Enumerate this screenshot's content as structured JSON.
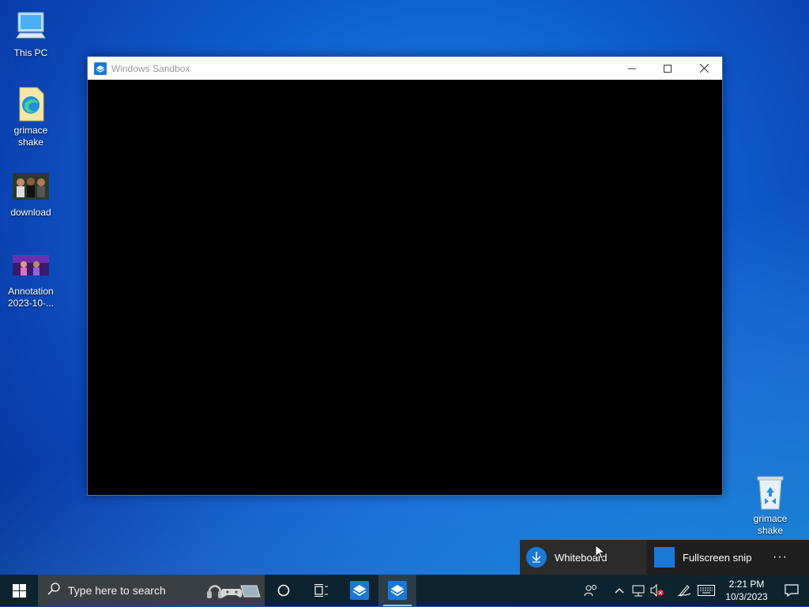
{
  "desktop": {
    "icons": [
      {
        "label": "This PC",
        "icon": "computer-icon"
      },
      {
        "label": "grimace shake",
        "icon": "edge-file-icon"
      },
      {
        "label": "download",
        "icon": "image-thumbnail-icon"
      },
      {
        "label": "Annotation 2023-10-...",
        "icon": "image-thumbnail-icon"
      },
      {
        "label": "grimace shake",
        "icon": "recycle-bin-icon"
      }
    ]
  },
  "window": {
    "title": "Windows Sandbox",
    "icon": "sandbox-icon",
    "controls": {
      "minimize": "minimize-icon",
      "maximize": "maximize-icon",
      "close": "close-icon"
    }
  },
  "snip_toolbar": {
    "whiteboard_label": "Whiteboard",
    "fullscreen_label": "Fullscreen snip",
    "more_label": "···"
  },
  "taskbar": {
    "search_placeholder": "Type here to search",
    "time": "2:21 PM",
    "date": "10/3/2023"
  },
  "colors": {
    "accent": "#1a78d6",
    "taskbar": "#0d2330",
    "search_box": "#3a3f44"
  }
}
